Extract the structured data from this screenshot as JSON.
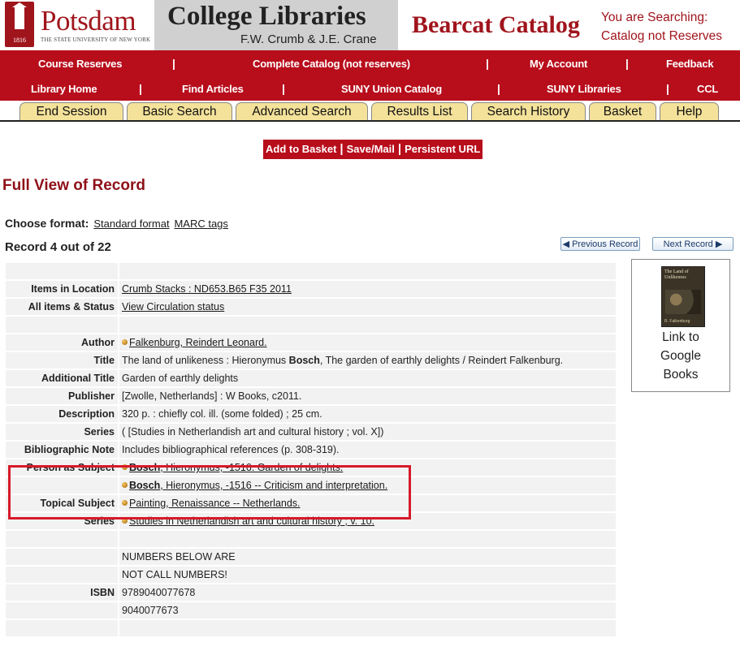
{
  "header": {
    "logo_name": "Potsdam",
    "logo_subtitle": "THE STATE UNIVERSITY OF NEW YORK",
    "logo_year": "1816",
    "college_title": "College Libraries",
    "college_subtitle": "F.W. Crumb & J.E. Crane",
    "catalog_title": "Bearcat Catalog",
    "searching_line1": "You are Searching:",
    "searching_line2": "Catalog not Reserves"
  },
  "nav_row1": [
    "Course Reserves",
    "Complete Catalog (not reserves)",
    "My Account",
    "Feedback"
  ],
  "nav_row2": [
    "Library Home",
    "Find Articles",
    "SUNY Union Catalog",
    "SUNY Libraries",
    "CCL"
  ],
  "separator": "|",
  "tabs": [
    "End Session",
    "Basic Search",
    "Advanced Search",
    "Results List",
    "Search History",
    "Basket",
    "Help"
  ],
  "actions": [
    "Add to Basket",
    "Save/Mail",
    "Persistent URL"
  ],
  "page_heading": "Full View of Record",
  "choose_format": {
    "label": "Choose format:",
    "options": [
      "Standard format",
      "MARC tags"
    ]
  },
  "record_count": "Record 4 out of 22",
  "navigation": {
    "previous": "Previous Record",
    "next": "Next Record"
  },
  "google_books": {
    "label_line1": "Link to",
    "label_line2": "Google",
    "label_line3": "Books",
    "cover_title": "The Land of Unlikeness",
    "cover_author": "R. Falkenburg"
  },
  "record": {
    "items_in_location": {
      "label": "Items in Location",
      "value": "Crumb Stacks : ND653.B65 F35 2011"
    },
    "all_items_status": {
      "label": "All items & Status",
      "value": "View Circulation status"
    },
    "author": {
      "label": "Author",
      "value": "Falkenburg, Reindert Leonard."
    },
    "title": {
      "label": "Title",
      "before": "The land of unlikeness : Hieronymus ",
      "bold": "Bosch",
      "after": ", The garden of earthly delights / Reindert Falkenburg."
    },
    "additional_title": {
      "label": "Additional Title",
      "value": "Garden of earthly delights"
    },
    "publisher": {
      "label": "Publisher",
      "value": "[Zwolle, Netherlands] : W Books, c2011."
    },
    "description": {
      "label": "Description",
      "value": "320 p. : chiefly col. ill. (some folded) ; 25 cm."
    },
    "series1": {
      "label": "Series",
      "value": "( [Studies in Netherlandish art and cultural history ; vol. X])"
    },
    "bibliographic_note": {
      "label": "Bibliographic Note",
      "value": "Includes bibliographical references (p. 308-319)."
    },
    "person_subject": {
      "label": "Person as Subject",
      "entries": [
        {
          "bold": "Bosch",
          "rest": ", Hieronymus, -1516. Garden of delights."
        },
        {
          "bold": "Bosch",
          "rest": ", Hieronymus, -1516 -- Criticism and interpretation."
        }
      ]
    },
    "topical_subject": {
      "label": "Topical Subject",
      "value": "Painting, Renaissance -- Netherlands."
    },
    "series2": {
      "label": "Series",
      "value": "Studies in Netherlandish art and cultural history ; v. 10."
    },
    "note_line1": "NUMBERS BELOW ARE",
    "note_line2": "NOT CALL NUMBERS!",
    "isbn": {
      "label": "ISBN",
      "values": [
        "9789040077678",
        "9040077673"
      ]
    }
  },
  "colors": {
    "brand_red": "#b80d1b",
    "heading_red": "#8e1018",
    "tab_yellow": "#f4e29a",
    "highlight_red": "#d71a2a"
  }
}
